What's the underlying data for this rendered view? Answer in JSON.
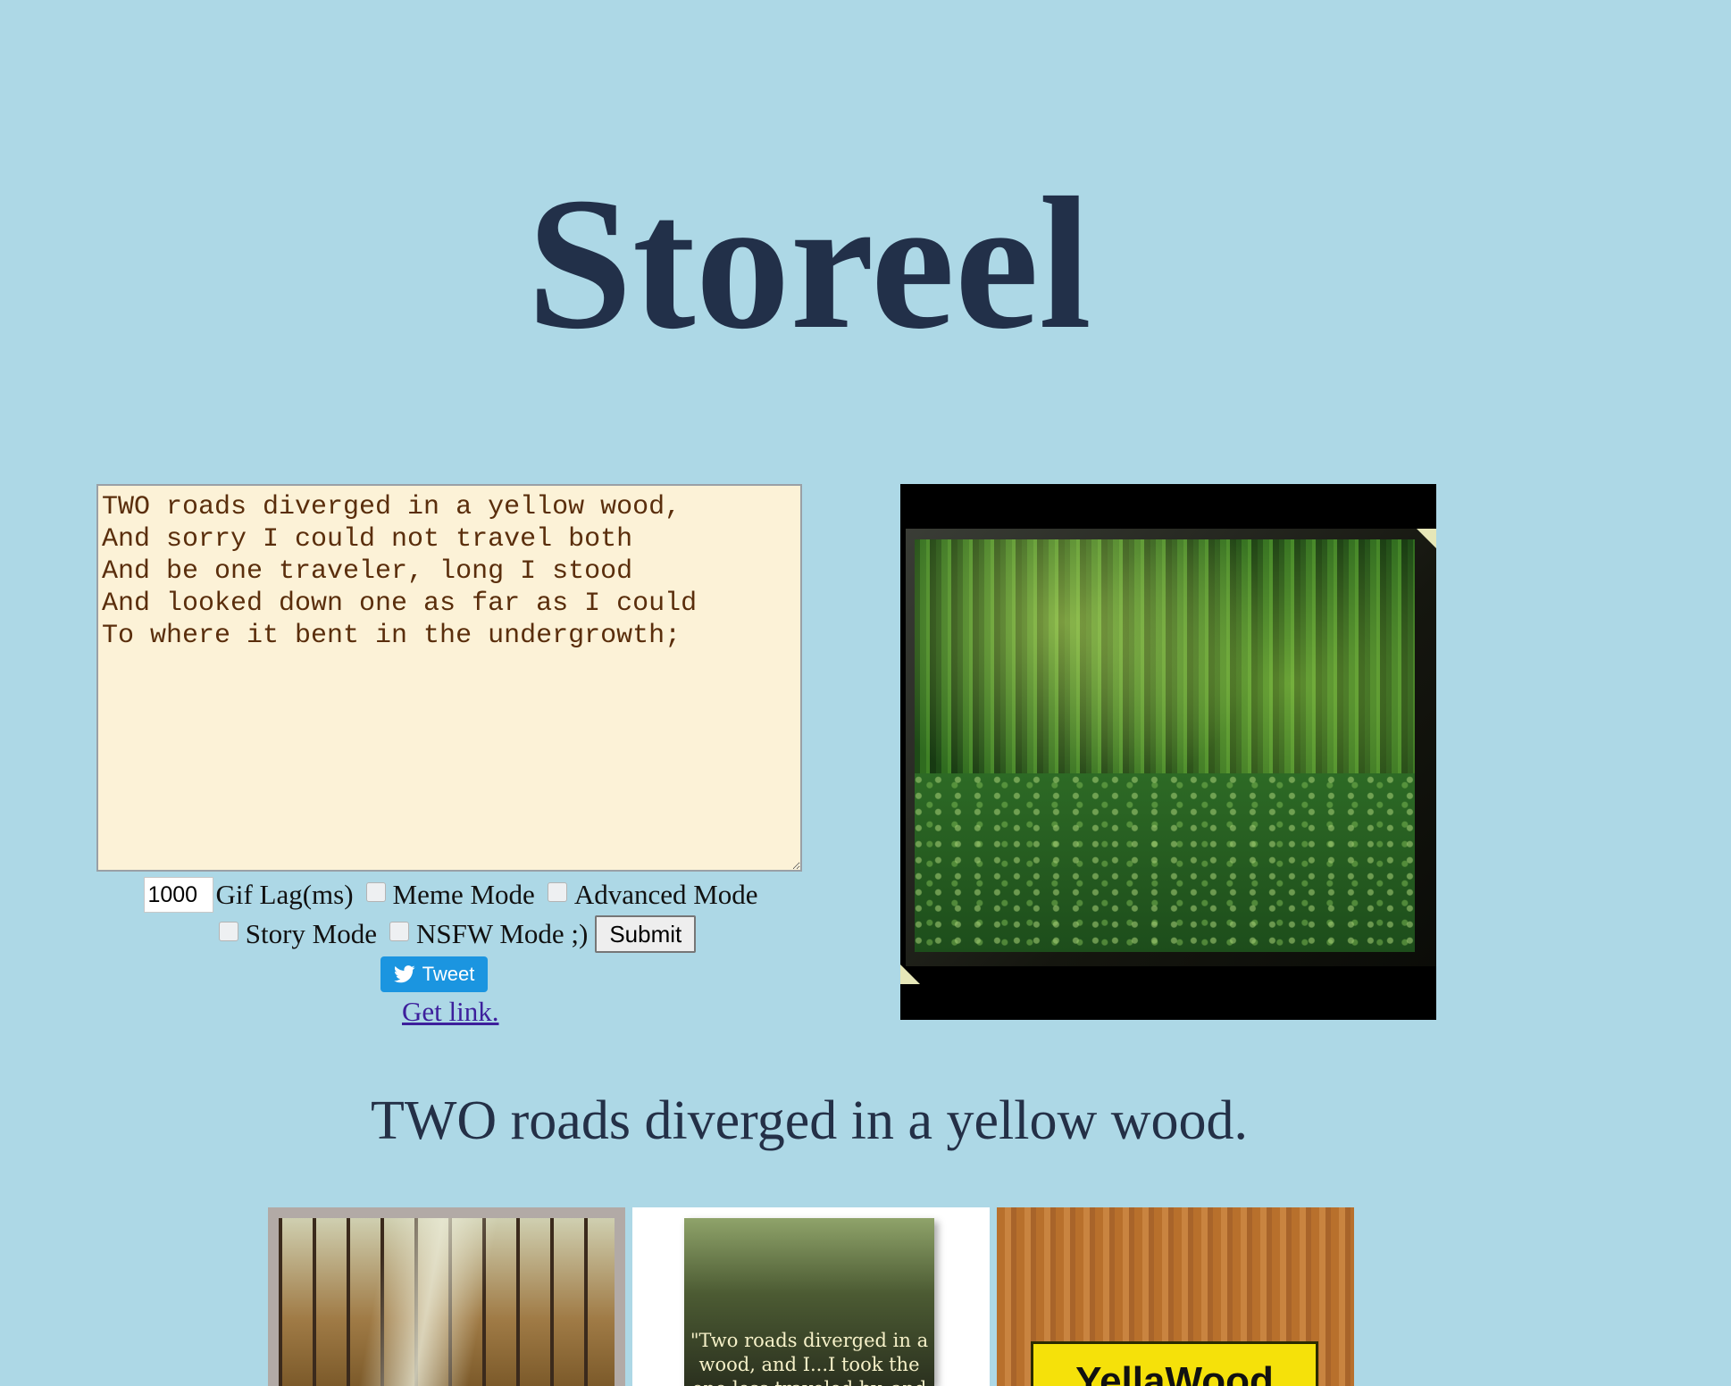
{
  "header": {
    "title": "Storeel"
  },
  "editor": {
    "text": "TWO roads diverged in a yellow wood,\nAnd sorry I could not travel both\nAnd be one traveler, long I stood\nAnd looked down one as far as I could\nTo where it bent in the undergrowth;"
  },
  "controls": {
    "gif_lag_value": "1000",
    "gif_lag_label": "Gif Lag(ms)",
    "meme_mode_label": "Meme Mode",
    "advanced_mode_label": "Advanced Mode",
    "story_mode_label": "Story Mode",
    "nsfw_mode_label": "NSFW Mode ;)",
    "submit_label": "Submit",
    "tweet_label": "Tweet",
    "get_link_label": "Get link.",
    "checkboxes": {
      "meme_mode": false,
      "advanced_mode": false,
      "story_mode": false,
      "nsfw_mode": false
    }
  },
  "preview": {
    "icon": "forest-painting-image"
  },
  "results": {
    "caption": "TWO roads diverged in a yellow wood.",
    "thumbnails": [
      {
        "icon": "autumn-forest-path-image"
      },
      {
        "icon": "forest-quote-image",
        "text": "\"Two roads diverged in a wood, and I...I took the one less traveled by, and that"
      },
      {
        "icon": "yellawood-sign-image",
        "text": "YellaWood"
      }
    ]
  },
  "colors": {
    "background": "#add8e6",
    "title": "#223049",
    "editor_bg": "#fcf2d7",
    "editor_text": "#5a2e0c",
    "tweet": "#1b95e0",
    "link": "#3d1f9c"
  }
}
